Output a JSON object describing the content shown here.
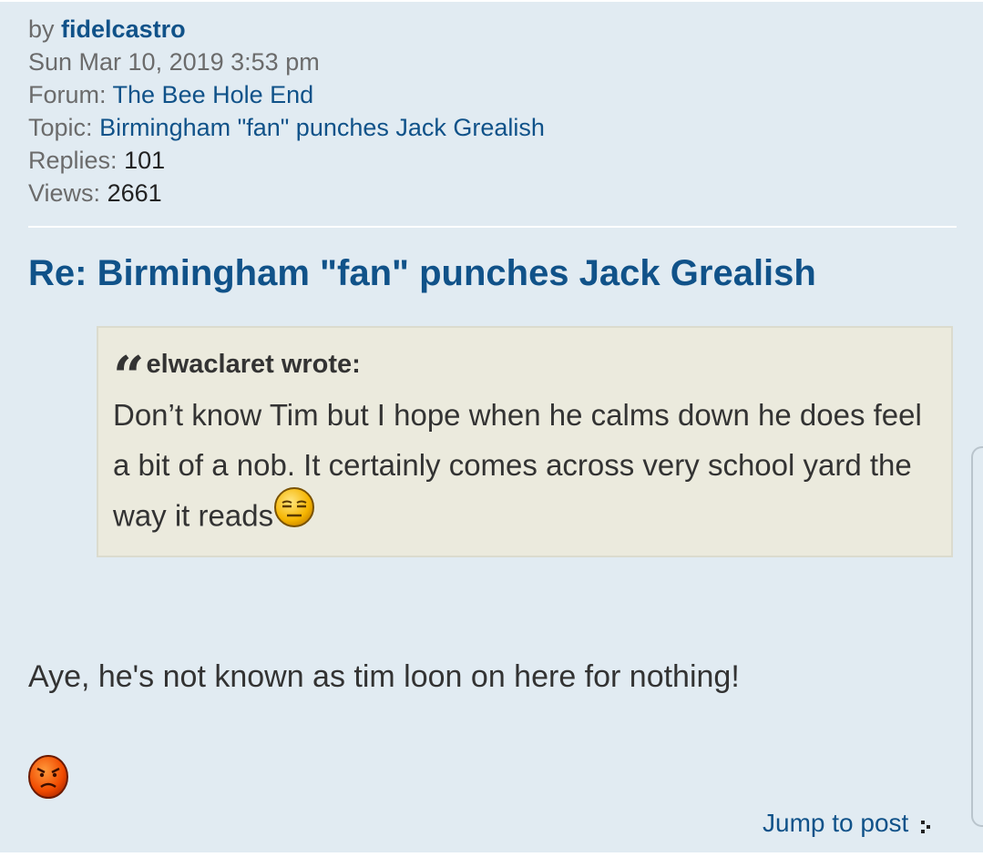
{
  "meta": {
    "by_label": "by",
    "author": "fidelcastro",
    "date": "Sun Mar 10, 2019 3:53 pm",
    "forum_label": "Forum:",
    "forum": "The Bee Hole End",
    "topic_label": "Topic:",
    "topic": "Birmingham \"fan\" punches Jack Grealish",
    "replies_label": "Replies:",
    "replies": "101",
    "views_label": "Views:",
    "views": "2661"
  },
  "post": {
    "title": "Re: Birmingham \"fan\" punches Jack Grealish",
    "quote": {
      "author_line": "elwaclaret wrote:",
      "text": "Don’t know Tim but I hope when he calms down he does feel a bit of a nob. It certainly comes across very school yard the way it reads",
      "smiley": "expressionless-smiley-icon"
    },
    "reply_text": "Aye, he's not known as tim loon on here for nothing!",
    "reply_smiley": "angry-smiley-icon",
    "jump_label": "Jump to post"
  },
  "colors": {
    "background": "#e1ebf2",
    "link": "#105289",
    "quote_bg": "#ebeadd",
    "text": "#333333"
  }
}
